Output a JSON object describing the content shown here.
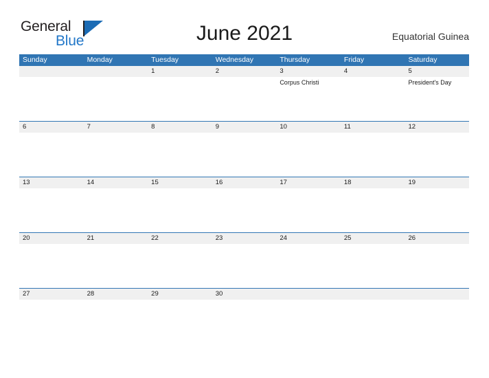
{
  "logo": {
    "word1": "General",
    "word2": "Blue",
    "accent_color": "#1c6cb5",
    "flag_icon": "blue-triangle-flag-icon"
  },
  "header": {
    "title": "June 2021",
    "country": "Equatorial Guinea"
  },
  "theme": {
    "header_blue": "#3075b3",
    "date_band_gray": "#f0f0f0",
    "row_divider": "#3075b3",
    "text_dark": "#1a1a1a"
  },
  "calendar": {
    "weekdays": [
      "Sunday",
      "Monday",
      "Tuesday",
      "Wednesday",
      "Thursday",
      "Friday",
      "Saturday"
    ],
    "weeks": [
      [
        {
          "date": "",
          "events": []
        },
        {
          "date": "",
          "events": []
        },
        {
          "date": "1",
          "events": []
        },
        {
          "date": "2",
          "events": []
        },
        {
          "date": "3",
          "events": [
            "Corpus Christi"
          ]
        },
        {
          "date": "4",
          "events": []
        },
        {
          "date": "5",
          "events": [
            "President's Day"
          ]
        }
      ],
      [
        {
          "date": "6",
          "events": []
        },
        {
          "date": "7",
          "events": []
        },
        {
          "date": "8",
          "events": []
        },
        {
          "date": "9",
          "events": []
        },
        {
          "date": "10",
          "events": []
        },
        {
          "date": "11",
          "events": []
        },
        {
          "date": "12",
          "events": []
        }
      ],
      [
        {
          "date": "13",
          "events": []
        },
        {
          "date": "14",
          "events": []
        },
        {
          "date": "15",
          "events": []
        },
        {
          "date": "16",
          "events": []
        },
        {
          "date": "17",
          "events": []
        },
        {
          "date": "18",
          "events": []
        },
        {
          "date": "19",
          "events": []
        }
      ],
      [
        {
          "date": "20",
          "events": []
        },
        {
          "date": "21",
          "events": []
        },
        {
          "date": "22",
          "events": []
        },
        {
          "date": "23",
          "events": []
        },
        {
          "date": "24",
          "events": []
        },
        {
          "date": "25",
          "events": []
        },
        {
          "date": "26",
          "events": []
        }
      ],
      [
        {
          "date": "27",
          "events": []
        },
        {
          "date": "28",
          "events": []
        },
        {
          "date": "29",
          "events": []
        },
        {
          "date": "30",
          "events": []
        },
        {
          "date": "",
          "events": []
        },
        {
          "date": "",
          "events": []
        },
        {
          "date": "",
          "events": []
        }
      ]
    ]
  }
}
